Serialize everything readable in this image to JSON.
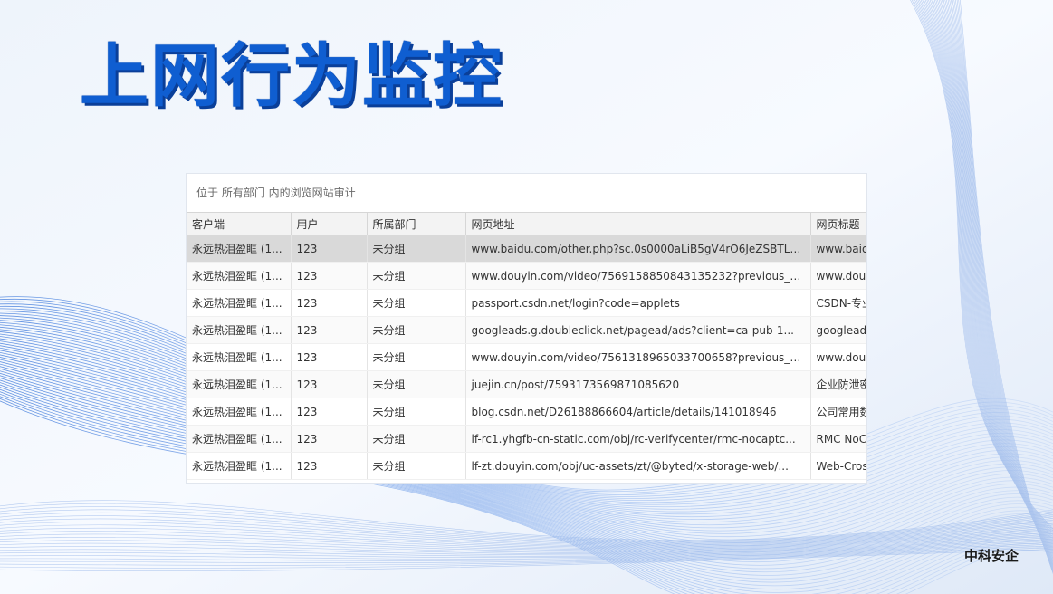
{
  "page": {
    "title": "上网行为监控",
    "brand": "中科安企"
  },
  "audit": {
    "caption": "位于 所有部门 内的浏览网站审计",
    "columns": [
      "客户端",
      "用户",
      "所属部门",
      "网页地址",
      "网页标题"
    ],
    "rows": [
      {
        "client": "永远热泪盈眶 (1...",
        "user": "123",
        "dept": "未分组",
        "url": "www.baidu.com/other.php?sc.0s0000aLiB5gV4rO6JeZSBTLR...",
        "title": "www.baidu"
      },
      {
        "client": "永远热泪盈眶 (1...",
        "user": "123",
        "dept": "未分组",
        "url": "www.douyin.com/video/7569158850843135232?previous_p...",
        "title": "www.douy"
      },
      {
        "client": "永远热泪盈眶 (1...",
        "user": "123",
        "dept": "未分组",
        "url": "passport.csdn.net/login?code=applets",
        "title": "CSDN-专业"
      },
      {
        "client": "永远热泪盈眶 (1...",
        "user": "123",
        "dept": "未分组",
        "url": "googleads.g.doubleclick.net/pagead/ads?client=ca-pub-1...",
        "title": "googlead"
      },
      {
        "client": "永远热泪盈眶 (1...",
        "user": "123",
        "dept": "未分组",
        "url": "www.douyin.com/video/7561318965033700658?previous_p...",
        "title": "www.douy"
      },
      {
        "client": "永远热泪盈眶 (1...",
        "user": "123",
        "dept": "未分组",
        "url": "juejin.cn/post/7593173569871085620",
        "title": "企业防泄密"
      },
      {
        "client": "永远热泪盈眶 (1...",
        "user": "123",
        "dept": "未分组",
        "url": "blog.csdn.net/D26188866604/article/details/141018946",
        "title": "公司常用数"
      },
      {
        "client": "永远热泪盈眶 (1...",
        "user": "123",
        "dept": "未分组",
        "url": "lf-rc1.yhgfb-cn-static.com/obj/rc-verifycenter/rmc-nocaptc...",
        "title": "RMC NoC"
      },
      {
        "client": "永远热泪盈眶 (1...",
        "user": "123",
        "dept": "未分组",
        "url": "lf-zt.douyin.com/obj/uc-assets/zt/@byted/x-storage-web/...",
        "title": "Web-Cros"
      }
    ]
  }
}
